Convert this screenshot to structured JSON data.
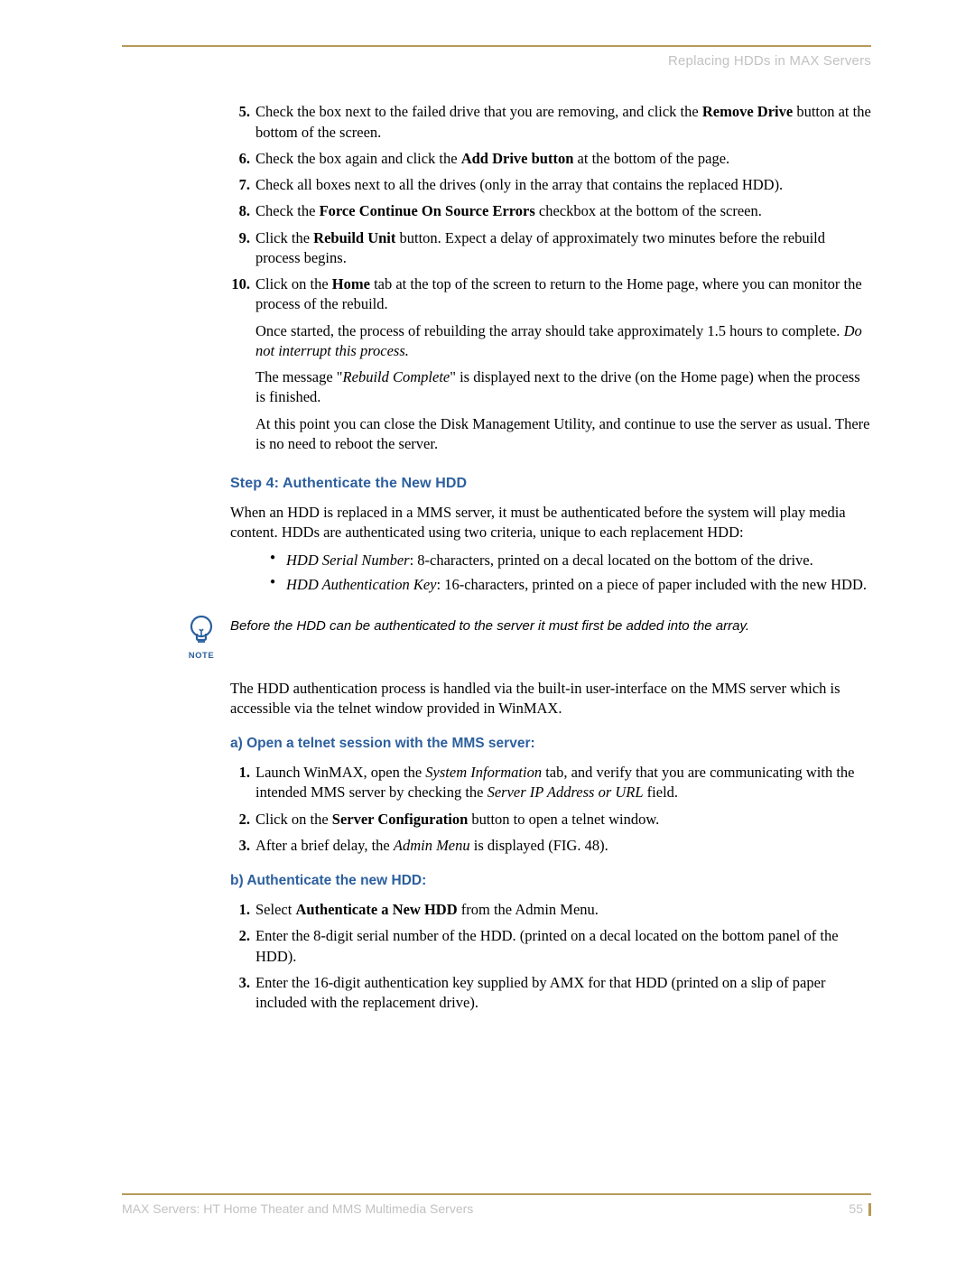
{
  "header": {
    "title": "Replacing HDDs in MAX Servers"
  },
  "list1": {
    "item5_a": "Check the box next to the failed drive that you are removing, and click the ",
    "item5_bold": "Remove Drive",
    "item5_b": " button at the bottom of the screen.",
    "item6_a": "Check the box again and click the ",
    "item6_bold": "Add Drive button",
    "item6_b": " at the bottom of the page.",
    "item7": "Check all boxes next to all the drives (only in the array that contains the replaced HDD).",
    "item8_a": "Check the ",
    "item8_bold": "Force Continue On Source Errors",
    "item8_b": " checkbox at the bottom of the screen.",
    "item9_a": "Click the ",
    "item9_bold": "Rebuild Unit",
    "item9_b": " button. Expect a delay of approximately two minutes before the rebuild process begins.",
    "item10_a": "Click on the ",
    "item10_bold": "Home",
    "item10_b": " tab at the top of the screen to return to the Home page, where you can monitor the process of the rebuild.",
    "item10_p2_a": "Once started, the process of rebuilding the array should take approximately 1.5 hours to complete. ",
    "item10_p2_i": "Do not interrupt this process.",
    "item10_p3_a": "The message \"",
    "item10_p3_i": "Rebuild Complete",
    "item10_p3_b": "\" is displayed next to the drive (on the Home page) when the process is finished.",
    "item10_p4": "At this point you can close the Disk Management Utility, and continue to use the server as usual. There is no need to reboot the server."
  },
  "step4": {
    "heading": "Step 4: Authenticate the New HDD",
    "intro": "When an HDD is replaced in a MMS server, it must be authenticated before the system will play media content. HDDs are authenticated using two criteria, unique to each replacement HDD:",
    "bullet1_i": "HDD Serial Number",
    "bullet1_rest": ": 8-characters, printed on a decal located on the bottom of the drive.",
    "bullet2_i": "HDD Authentication Key",
    "bullet2_rest": ": 16-characters, printed on a piece of paper included with the new HDD."
  },
  "note": {
    "label": "NOTE",
    "text": "Before the HDD can be authenticated to the server it must first be added into the array."
  },
  "after_note": "The HDD authentication process is handled via the built-in user-interface on the MMS server which is accessible via the telnet window provided in WinMAX.",
  "sectionA": {
    "heading": "a) Open a telnet session with the MMS server:",
    "item1_a": "Launch WinMAX, open the ",
    "item1_i1": "System Information",
    "item1_b": " tab, and verify that you are communicating with the intended MMS server by checking the ",
    "item1_i2": "Server IP Address or URL",
    "item1_c": " field.",
    "item2_a": "Click on the ",
    "item2_bold": "Server Configuration",
    "item2_b": " button to open a telnet window.",
    "item3_a": "After a brief delay, the ",
    "item3_i": "Admin Menu",
    "item3_b": " is displayed (FIG. 48)."
  },
  "sectionB": {
    "heading": "b) Authenticate the new HDD:",
    "item1_a": "Select ",
    "item1_bold": "Authenticate a New HDD",
    "item1_b": " from the Admin Menu.",
    "item2": "Enter the 8-digit serial number of the HDD. (printed on a decal located on the bottom panel of the HDD).",
    "item3": "Enter the 16-digit authentication key supplied by AMX for that HDD (printed on a slip of paper included with the replacement drive)."
  },
  "footer": {
    "left": "MAX Servers: HT Home Theater and MMS Multimedia Servers",
    "page": "55"
  }
}
